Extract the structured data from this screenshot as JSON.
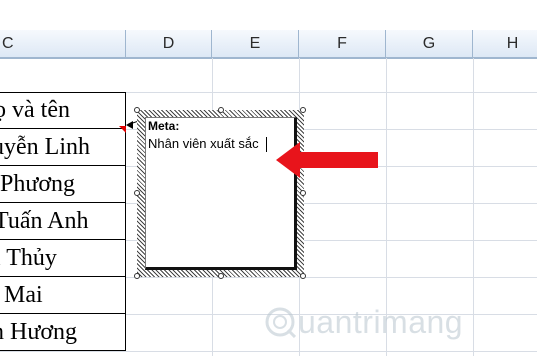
{
  "sheet": {
    "columns": [
      {
        "id": "col-c",
        "label": "C"
      },
      {
        "id": "col-d",
        "label": "D"
      },
      {
        "id": "col-e",
        "label": "E"
      },
      {
        "id": "col-f",
        "label": "F"
      },
      {
        "id": "col-g",
        "label": "G"
      },
      {
        "id": "col-h",
        "label": "H"
      }
    ],
    "names": [
      "ọ và tên",
      "uyễn Linh",
      "Phương",
      "Tuấn Anh",
      "ị Thủy",
      "Mai",
      "n Hương"
    ]
  },
  "comment": {
    "author": "Meta:",
    "text": "Nhân viên xuất sắc"
  },
  "colors": {
    "accent_red": "#e8141b",
    "header_bg": "#dde8f5",
    "comment_indicator": "#e00000"
  },
  "watermark": {
    "text": "uantrimang",
    "icon": "quantrimang-logo-icon"
  }
}
